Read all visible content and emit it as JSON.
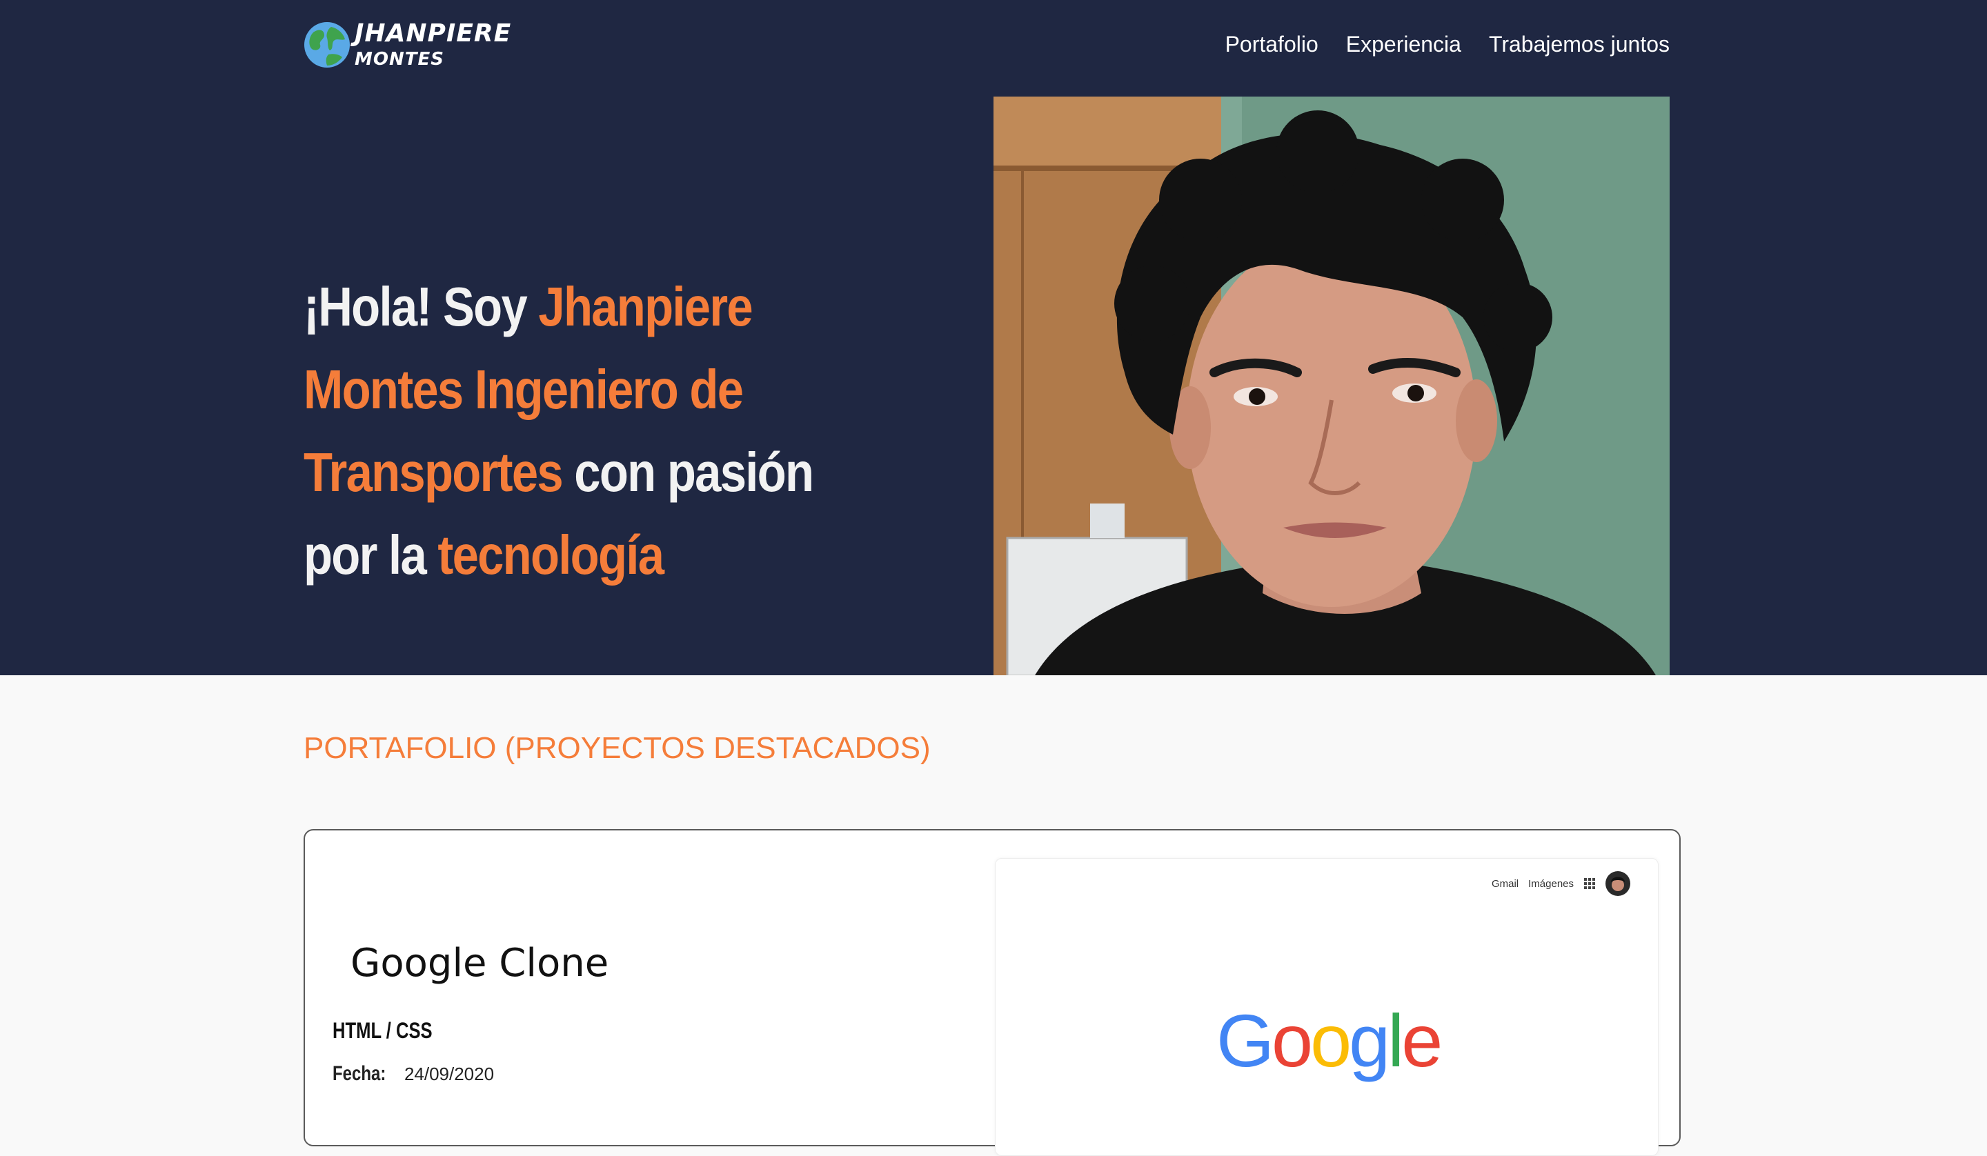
{
  "brand": {
    "name_line1": "JHANPIERE",
    "name_line2": "MONTES"
  },
  "nav": {
    "items": [
      "Portafolio",
      "Experiencia",
      "Trabajemos juntos"
    ]
  },
  "hero": {
    "greeting": "¡Hola! Soy ",
    "name": "Jhanpiere Montes",
    "role": "Ingeniero de Transportes",
    "connector": " con pasión por la ",
    "passion": "tecnología"
  },
  "portfolio": {
    "section_title": "PORTAFOLIO (PROYECTOS DESTACADOS)",
    "projects": [
      {
        "title": "Google Clone",
        "tech": "HTML / CSS",
        "date_label": "Fecha:",
        "date": "24/09/2020",
        "preview": {
          "links": [
            "Gmail",
            "Imágenes"
          ],
          "logo_letters": [
            "G",
            "o",
            "o",
            "g",
            "l",
            "e"
          ]
        }
      }
    ]
  },
  "colors": {
    "hero_bg": "#1f2742",
    "accent": "#f57d3a",
    "page_bg": "#f9f9f9",
    "google_blue": "#4285f4",
    "google_red": "#ea4335",
    "google_yellow": "#fbbc05",
    "google_green": "#34a853"
  },
  "icons": [
    "globe-icon",
    "apps-grid-icon",
    "avatar"
  ]
}
